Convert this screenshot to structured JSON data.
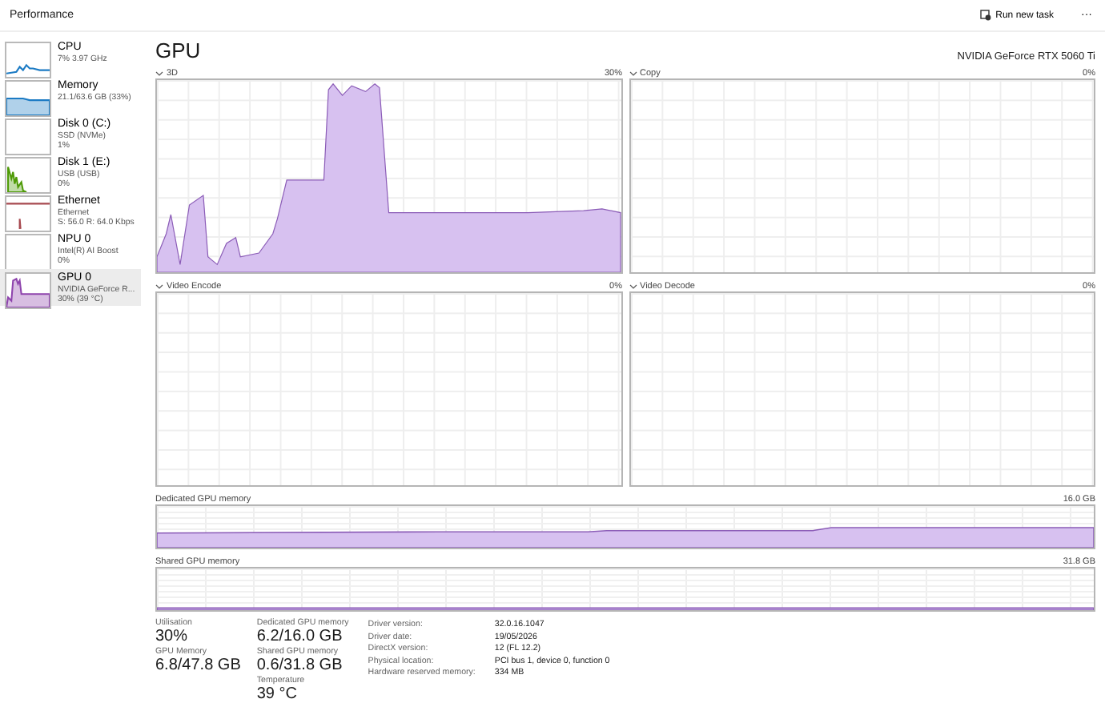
{
  "window": {
    "title": "Performance"
  },
  "toolbar": {
    "run_task": "Run new task",
    "more": "···"
  },
  "sidebar": {
    "items": [
      {
        "name": "CPU",
        "lines": [
          "7% 3.97 GHz"
        ],
        "kind": "line",
        "color": "#1c7bc4",
        "selected": false
      },
      {
        "name": "Memory",
        "lines": [
          "21.1/63.6 GB (33%)"
        ],
        "kind": "fill",
        "color": "#1c7bc4",
        "selected": false
      },
      {
        "name": "Disk 0 (C:)",
        "lines": [
          "SSD (NVMe)",
          "1%"
        ],
        "kind": "flat",
        "selected": false
      },
      {
        "name": "Disk 1 (E:)",
        "lines": [
          "USB (USB)",
          "0%"
        ],
        "kind": "bars",
        "color": "#4e9a06",
        "selected": false
      },
      {
        "name": "Ethernet",
        "lines": [
          "Ethernet",
          "S: 56.0 R: 64.0 Kbps"
        ],
        "kind": "spike",
        "color": "#a7494f",
        "selected": false
      },
      {
        "name": "NPU 0",
        "lines": [
          "Intel(R) AI Boost",
          "0%"
        ],
        "kind": "flat",
        "selected": false
      },
      {
        "name": "GPU 0",
        "lines": [
          "NVIDIA GeForce R...",
          "30% (39 °C)"
        ],
        "kind": "area",
        "color": "#8e44ad",
        "selected": true
      }
    ]
  },
  "header": {
    "title": "GPU",
    "device": "NVIDIA GeForce RTX 5060 Ti"
  },
  "engine_graphs": [
    {
      "title": "3D",
      "reading": "30%",
      "kind": "activity"
    },
    {
      "title": "Copy",
      "reading": "0%",
      "kind": "idle"
    },
    {
      "title": "Video Encode",
      "reading": "0%",
      "kind": "idle"
    },
    {
      "title": "Video Decode",
      "reading": "0%",
      "kind": "idle"
    }
  ],
  "memory_graphs": [
    {
      "title": "Dedicated GPU memory",
      "reading": "16.0 GB",
      "kind": "step"
    },
    {
      "title": "Shared GPU memory",
      "reading": "31.8 GB",
      "kind": "baseline"
    }
  ],
  "stat_columns": [
    [
      {
        "label": "Utilisation",
        "value": "30%"
      },
      {
        "label": "GPU Memory",
        "value": "6.8/47.8 GB"
      }
    ],
    [
      {
        "label": "Dedicated GPU memory",
        "value": "6.2/16.0 GB"
      },
      {
        "label": "Shared GPU memory",
        "value": "0.6/31.8 GB"
      },
      {
        "label": "Temperature",
        "value": "39 °C"
      }
    ]
  ],
  "details": [
    {
      "key": "Driver version:",
      "value": "32.0.16.1047"
    },
    {
      "key": "Driver date:",
      "value": "19/05/2026"
    },
    {
      "key": "DirectX version:",
      "value": "12 (FL 12.2)"
    },
    {
      "key": "Physical location:",
      "value": "PCI bus 1, device 0, function 0"
    },
    {
      "key": "Hardware reserved memory:",
      "value": "334 MB"
    }
  ]
}
